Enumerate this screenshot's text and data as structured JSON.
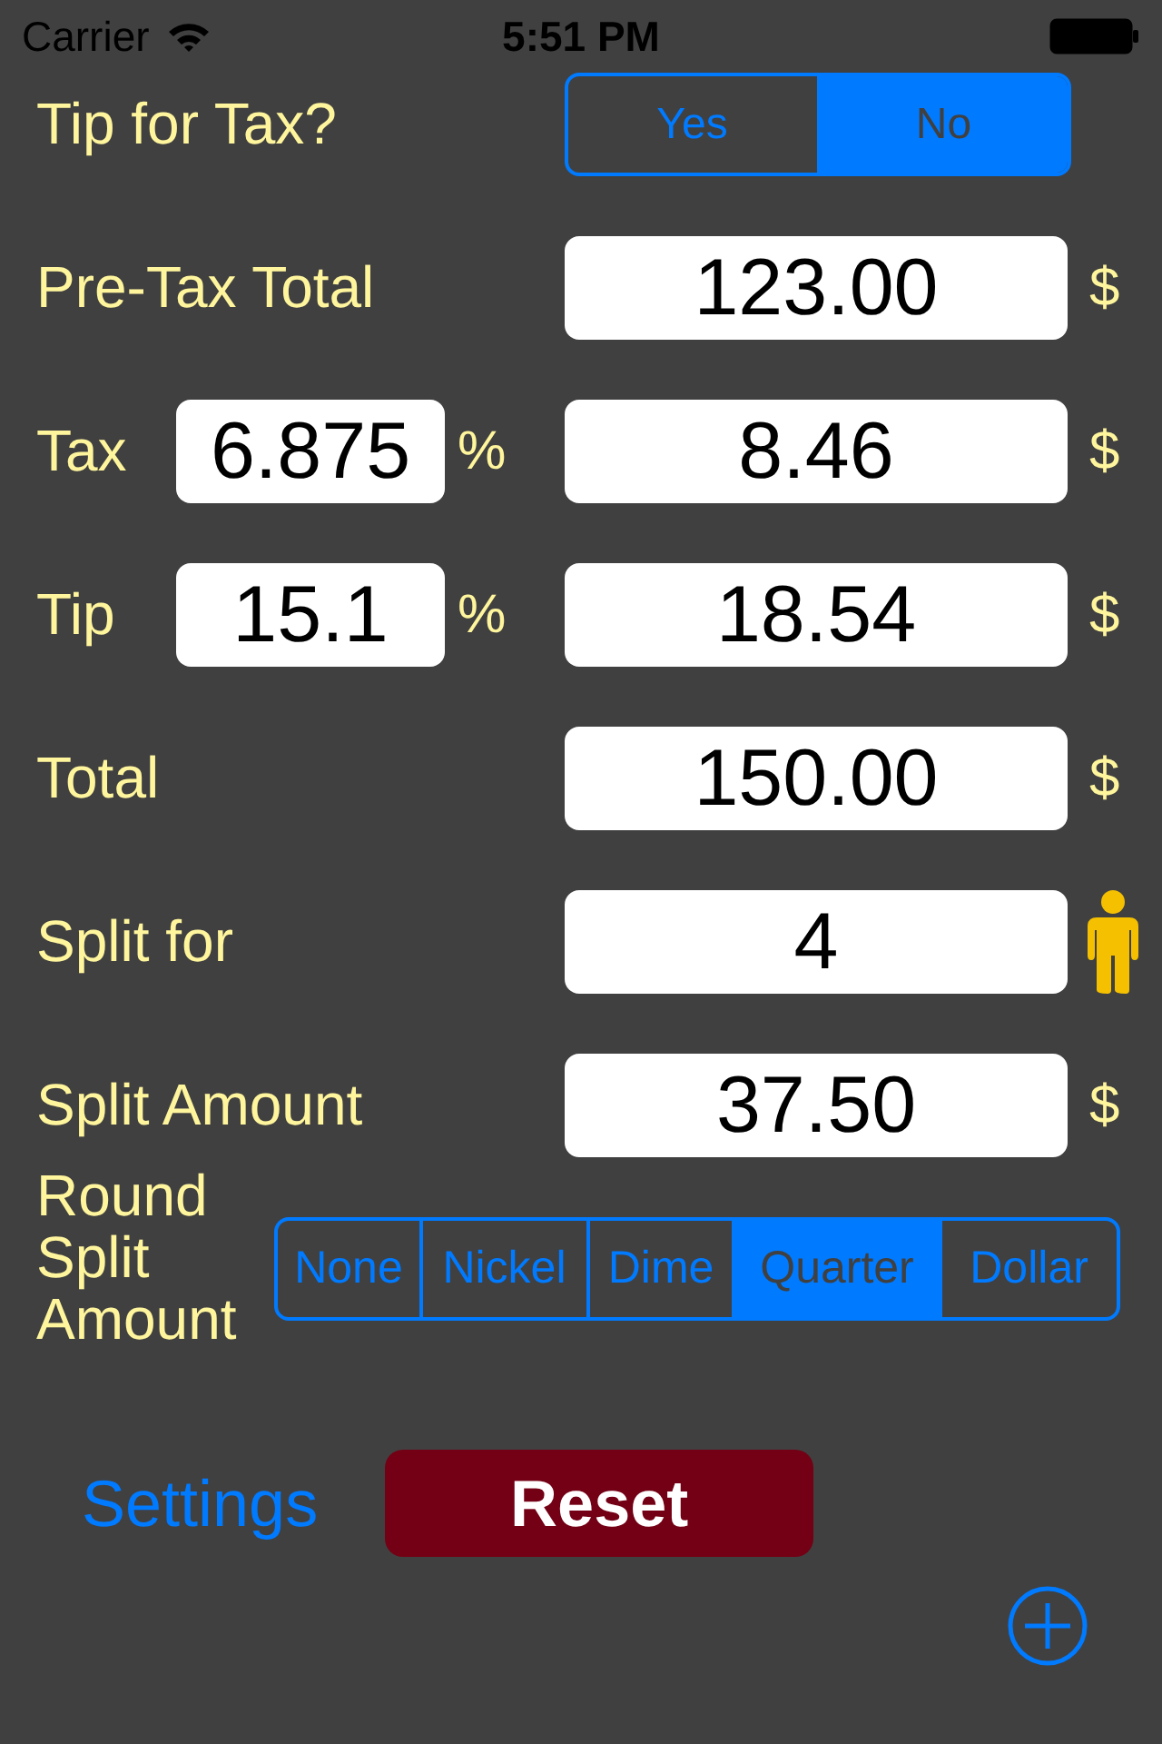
{
  "status_bar": {
    "carrier": "Carrier",
    "time": "5:51 PM"
  },
  "tip_for_tax": {
    "label": "Tip for Tax?",
    "options": [
      {
        "label": "Yes",
        "selected": false
      },
      {
        "label": "No",
        "selected": true
      }
    ]
  },
  "rows": [
    {
      "kind": "amount",
      "label": "Pre-Tax Total",
      "value": "123.00",
      "unit": "$"
    },
    {
      "kind": "rate",
      "label": "Tax",
      "rate": "6.875",
      "rate_unit": "%",
      "value": "8.46",
      "unit": "$"
    },
    {
      "kind": "rate",
      "label": "Tip",
      "rate": "15.1",
      "rate_unit": "%",
      "value": "18.54",
      "unit": "$"
    },
    {
      "kind": "amount",
      "label": "Total",
      "value": "150.00",
      "unit": "$"
    },
    {
      "kind": "people",
      "label": "Split for",
      "value": "4"
    },
    {
      "kind": "amount",
      "label": "Split Amount",
      "value": "37.50",
      "unit": "$"
    }
  ],
  "rounding": {
    "label": "Round Split Amount",
    "options": [
      {
        "label": "None",
        "selected": false
      },
      {
        "label": "Nickel",
        "selected": false
      },
      {
        "label": "Dime",
        "selected": false
      },
      {
        "label": "Quarter",
        "selected": true
      },
      {
        "label": "Dollar",
        "selected": false
      }
    ]
  },
  "settings_link": "Settings",
  "reset_button": "Reset"
}
